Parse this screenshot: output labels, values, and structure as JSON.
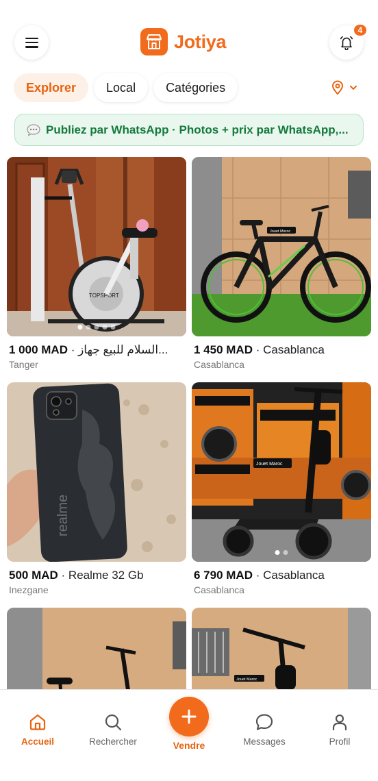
{
  "header": {
    "brand_name": "Jotiya",
    "notifications_count": "4",
    "menu_icon": "hamburger-menu-icon",
    "bell_icon": "bell-icon"
  },
  "tabs": [
    {
      "label": "Explorer",
      "active": true
    },
    {
      "label": "Local",
      "active": false
    },
    {
      "label": "Catégories",
      "active": false
    }
  ],
  "banner": {
    "icon": "speech-bubble-icon",
    "text": "Publiez par WhatsApp · Photos + prix par WhatsApp,..."
  },
  "listings": [
    {
      "price": "1 000 MAD",
      "title": "السلام  للبيع جهاز...",
      "city": "Tanger",
      "photos": 5,
      "current_photo": 1
    },
    {
      "price": "1 450 MAD",
      "title": "Casablanca",
      "city": "Casablanca",
      "photos": 1,
      "current_photo": 1
    },
    {
      "price": "500 MAD",
      "title": "Realme 32 Gb",
      "city": "Inezgane",
      "photos": 1,
      "current_photo": 1
    },
    {
      "price": "6 790 MAD",
      "title": "Casablanca",
      "city": "Casablanca",
      "photos": 2,
      "current_photo": 1
    },
    {
      "price": "",
      "title": "",
      "city": "",
      "photos": 1,
      "current_photo": 1
    },
    {
      "price": "",
      "title": "",
      "city": "",
      "photos": 1,
      "current_photo": 1
    }
  ],
  "photo_overlays": {
    "bike_sticker": "Jouet Maroc",
    "scooter_sticker": "Jouet Maroc",
    "bike3_sticker": "Jouet Maroc"
  },
  "bottom_nav": {
    "home": "Accueil",
    "search": "Rechercher",
    "sell": "Vendre",
    "messages": "Messages",
    "profile": "Profil"
  },
  "colors": {
    "accent": "#f26a1b",
    "whatsapp_green": "#157a3c"
  }
}
